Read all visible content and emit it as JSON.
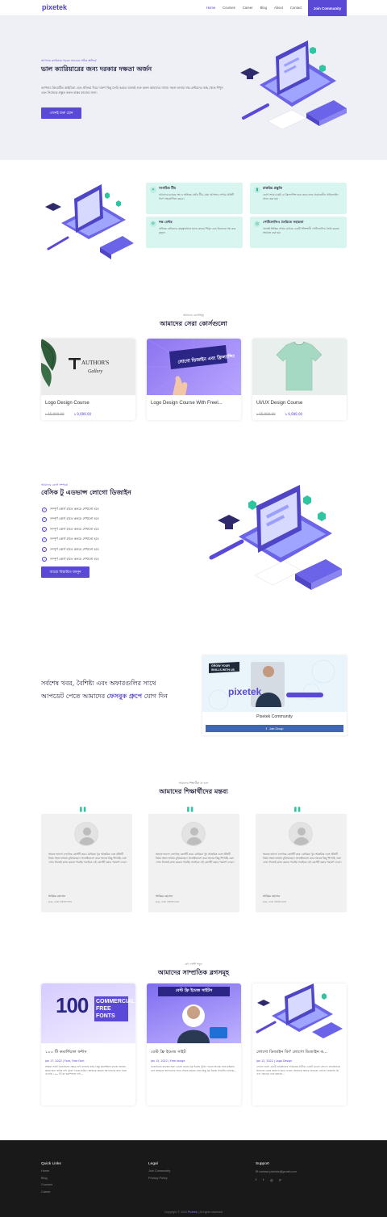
{
  "nav": {
    "logo": "pixetek",
    "links": [
      "Home",
      "Courses",
      "Career",
      "Blog",
      "About",
      "Contact"
    ],
    "join": "Join Community"
  },
  "hero": {
    "eyebrow": "আপনার ক্যারিয়ার গড়তে সবচেয়ে সঠিক প্লাটফর্ম",
    "title": "ভাল ক্যারিয়ারের জন্য দরকার দক্ষতা অর্জন",
    "desc": "আপনার ক্রিয়েটিভ আইডিয়া এবং প্রতিভা দিয়ে দারুণ কিছু তৈরি করতে আজই শুরু করুন আমাদের সাথে। সহজ ভাষায় দক্ষ মেন্টরদের কাছ থেকে শিখুন এবং নিজেকে প্রস্তুত করুন বাস্তব কাজের জন্য।",
    "cta": "এখনই শুরু হোন"
  },
  "features": [
    {
      "title": "সংগঠিত টীম",
      "desc": "আমাদের রয়েছে দক্ষ ও অভিজ্ঞ মেন্টর টীম, যারা আপনার শেখার প্রতিটি ধাপে সহযোগিতা করবে।",
      "icon": "lightbulb-icon"
    },
    {
      "title": "চাকরির প্রস্তুতি",
      "desc": "কোর্স শেষে চাকরি বা ফ্রিল্যান্সিং শুরু করার জন্য প্রয়োজনীয় গাইডলাইন প্রদান করা হয়।",
      "icon": "bookmark-icon"
    },
    {
      "title": "দক্ষ মেন্টর",
      "desc": "অভিজ্ঞ মেন্টরদের তত্ত্বাবধানে হাতে কলমে শিখুন এবং নিজেকে দক্ষ করে তুলুন।",
      "icon": "gear-icon"
    },
    {
      "title": "পোর্টফোলিও তৈরিতে সহায়তা",
      "desc": "প্রজেক্ট ভিত্তিক শেখার মাধ্যমে একটি শক্তিশালী পোর্টফোলিও তৈরি করতে সহায়তা করা হয়।",
      "icon": "target-icon"
    }
  ],
  "courses": {
    "eyebrow": "আমাদের কোর্সসমূহ",
    "title": "আমাদের সেরা কোর্সগুলো",
    "items": [
      {
        "title": "Logo Design Course",
        "old": "৳ 15,000.00",
        "price": "৳ 9,999.00",
        "thumb": "author-thumb"
      },
      {
        "title": "Logo Design Course With Freel...",
        "old": "",
        "price": "",
        "thumb": "logo-course-thumb",
        "badge": "লোগো ডিজাইন এবং ফ্রিল্যান্সিং"
      },
      {
        "title": "UI/UX Design Course",
        "old": "৳ 15,000.00",
        "price": "৳ 9,999.00",
        "thumb": "tshirt-thumb"
      }
    ]
  },
  "logo_section": {
    "eyebrow": "আমাদের কোর্স সম্পর্কে",
    "title": "বেসিক টু এডভান্স লোগো ডিজাইন",
    "items": [
      "সম্পূর্ণ কোর্স হাতে কলমে শেখানো হবে",
      "সম্পূর্ণ কোর্স হাতে কলমে শেখানো হবে",
      "সম্পূর্ণ কোর্স হাতে কলমে শেখানো হবে",
      "সম্পূর্ণ কোর্স হাতে কলমে শেখানো হবে",
      "সম্পূর্ণ কোর্স হাতে কলমে শেখানো হবে",
      "সম্পূর্ণ কোর্স হাতে কলমে শেখানো হবে"
    ],
    "cta": "আরো বিস্তারিত জানুন"
  },
  "community": {
    "line1": "সর্বশেষ খবর, বৈশিষ্ট্য এবং অফারগুলির সাথে",
    "line2": "আপডেট পেতে আমাদের",
    "highlight": "ফেসবুক গ্রুপে",
    "line2_end": "যোগ দিন",
    "group_name": "Pixetek Community",
    "join": "Join Group",
    "banner_text": "GROW YOUR SKILLS WITH US",
    "banner_logo": "pixetek"
  },
  "testimonials": {
    "eyebrow": "আমাদের শিক্ষার্থীরা যা বলে",
    "title": "আমাদের শিক্ষার্থীদের মন্তব্য",
    "items": [
      {
        "text": "অনেক ভালো লেগেছে কোর্সটি করে। মেন্টররা খুব আন্তরিক এবং প্রতিটি বিষয় সহজ ভাষায় বুঝিয়েছেন। প্রজেক্টগুলো করে অনেক কিছু শিখেছি এবং এখন নিজেই কাজ করতে পারছি। সবাইকে এই কোর্সটি করার পরামর্শ দেবো।",
        "name": "সাব্বির হোসেন",
        "role": "ছাত্র, ঢাকা বিশ্ববিদ্যালয়"
      },
      {
        "text": "অনেক ভালো লেগেছে কোর্সটি করে। মেন্টররা খুব আন্তরিক এবং প্রতিটি বিষয় সহজ ভাষায় বুঝিয়েছেন। প্রজেক্টগুলো করে অনেক কিছু শিখেছি এবং এখন নিজেই কাজ করতে পারছি। সবাইকে এই কোর্সটি করার পরামর্শ দেবো।",
        "name": "সাব্বির হোসেন",
        "role": "ছাত্র, ঢাকা বিশ্ববিদ্যালয়"
      },
      {
        "text": "অনেক ভালো লেগেছে কোর্সটি করে। মেন্টররা খুব আন্তরিক এবং প্রতিটি বিষয় সহজ ভাষায় বুঝিয়েছেন। প্রজেক্টগুলো করে অনেক কিছু শিখেছি এবং এখন নিজেই কাজ করতে পারছি। সবাইকে এই কোর্সটি করার পরামর্শ দেবো।",
        "name": "সাব্বির হোসেন",
        "role": "ছাত্র, ঢাকা বিশ্ববিদ্যালয়"
      }
    ]
  },
  "blog": {
    "eyebrow": "ব্লগ পোস্ট পড়ুন",
    "title": "আমাদের সাম্প্রতিক ব্লগসমূহ",
    "items": [
      {
        "title": "১০০ টি কমার্শিয়াল ফন্টস",
        "meta": "Jan 17, 2022 | Font, Free Font",
        "excerpt": "আমরা সবাই ডিজাইনের ক্ষেত্রে ফন্ট ব্যবহার করি। কিন্তু কমার্শিয়াল কাজে ব্যবহার করার জন্য সঠিক ফন্ট খুঁজে পাওয়া কঠিন। আজকে আমরা আপনাদের জন্য নিয়ে এসেছি ১০০ টি ফ্রি কমার্শিয়াল ফন্ট...",
        "thumb": "fonts-thumb",
        "big": "100",
        "sub": "COMMERCIAL FREE FONTS"
      },
      {
        "title": "বেস্ট ফ্রি ইমেজ সাইট",
        "meta": "Jan 15, 2022 | Free Image",
        "excerpt": "ডিজাইনের কাজের জন্য ভালো মানের ফ্রি ইমেজ খুঁজে পাওয়া অনেক সময় কষ্টকর। তাই আজকে আপনাদের সাথে শেয়ার করবো সেরা কিছু ফ্রি ইমেজ সাইটের তালিকা...",
        "thumb": "images-thumb",
        "head": "বেস্ট ফ্রি ইমেজ সাইটস"
      },
      {
        "title": "লোগো ডিজাইন কি? লোগো ডিজাইন ক...",
        "meta": "Jan 12, 2022 | Logo Design",
        "excerpt": "লোগো হলো একটি প্রতিষ্ঠানের পরিচয়ের প্রতীক। একটি ভালো লোগো প্রতিষ্ঠানকে অন্যদের থেকে আলাদা করে তোলে। আজকে আমরা জানবো লোগো ডিজাইন কি এবং কিভাবে শুরু করবেন...",
        "thumb": "laptop-thumb"
      }
    ]
  },
  "footer": {
    "cols": [
      {
        "title": "Quick Links",
        "links": [
          "Home",
          "Blog",
          "Courses",
          "Career"
        ]
      },
      {
        "title": "Legal",
        "links": [
          "Join Community",
          "Privacy Policy"
        ]
      },
      {
        "title": "Support",
        "links": [
          "contact.pixetek@gmail.com"
        ]
      }
    ],
    "copyright": "Copyright © 2020",
    "brand": "Pixetek",
    "rights": "| All rights reserved",
    "socials": [
      "facebook-icon",
      "twitter-icon",
      "instagram-icon",
      "pinterest-icon"
    ]
  },
  "colors": {
    "primary": "#5a48d6",
    "mint": "#d9f5ef",
    "accent": "#2fc5a0",
    "hero_bg": "#eef0f6",
    "footer_bg": "#191919"
  }
}
